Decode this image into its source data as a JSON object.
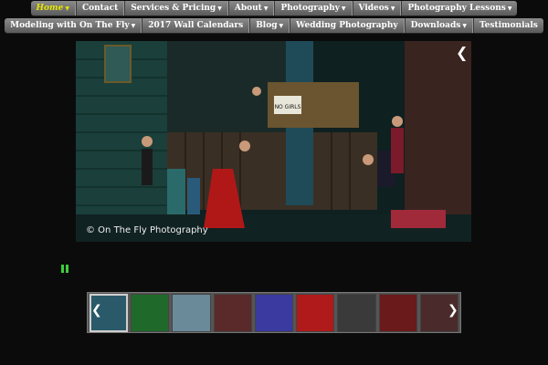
{
  "nav_top": [
    {
      "label": "Home",
      "caret": true,
      "active": true
    },
    {
      "label": "Contact",
      "caret": false
    },
    {
      "label": "Services & Pricing",
      "caret": true
    },
    {
      "label": "About",
      "caret": true
    },
    {
      "label": "Photography",
      "caret": true
    },
    {
      "label": "Videos",
      "caret": true
    },
    {
      "label": "Photography Lessons",
      "caret": true
    }
  ],
  "nav_bottom": [
    {
      "label": "Modeling with On The Fly",
      "caret": true
    },
    {
      "label": "2017 Wall Calendars",
      "caret": false
    },
    {
      "label": "Blog",
      "caret": true
    },
    {
      "label": "Wedding Photography",
      "caret": false
    },
    {
      "label": "Downloads",
      "caret": true
    },
    {
      "label": "Testimonials",
      "caret": false
    }
  ],
  "slideshow": {
    "watermark": "© On The Fly Photography",
    "sign_text": "NO GIRLS",
    "prev_symbol": "❮",
    "next_symbol": "❯"
  },
  "thumbnails": {
    "prev_symbol": "❮",
    "next_symbol": "❯",
    "colors": [
      "#2a5a6a",
      "#1f6a2a",
      "#6a8a9a",
      "#5a2a2a",
      "#3a3aa0",
      "#b01a1a",
      "#3a3a3a",
      "#6a1a1a",
      "#4a2a2a"
    ]
  },
  "colors": {
    "nav_active": "#e6e600",
    "pause": "#3bcf3b"
  }
}
